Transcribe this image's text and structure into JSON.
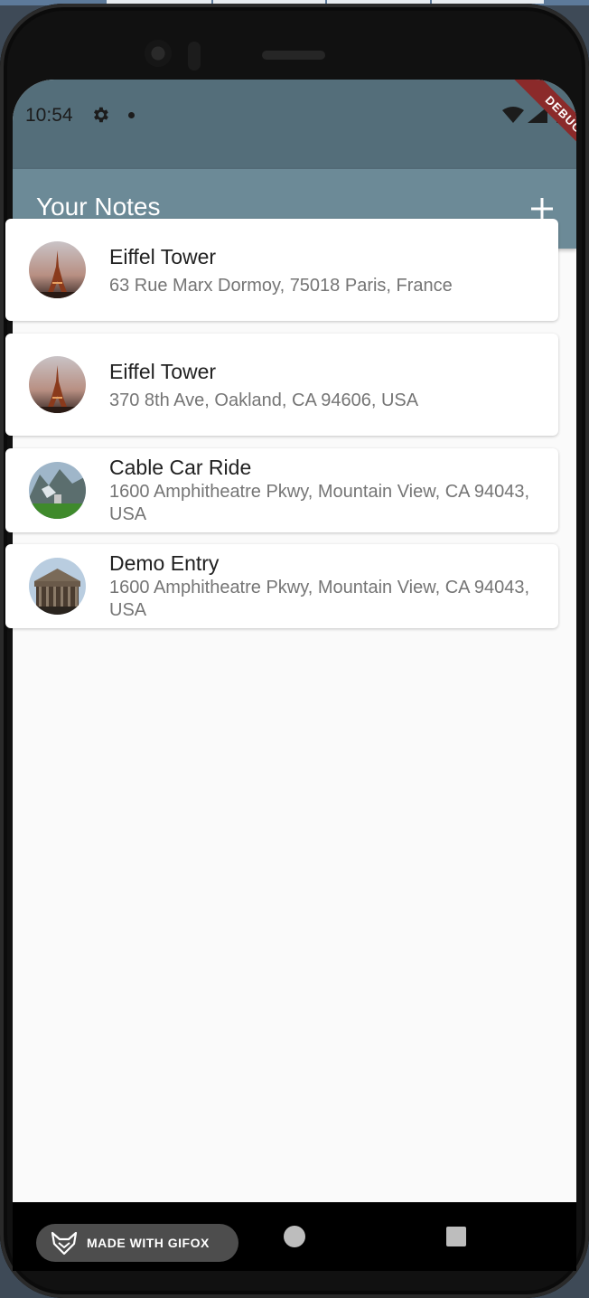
{
  "status_bar": {
    "time": "10:54",
    "debug_label": "DEBUG"
  },
  "app_bar": {
    "title": "Your Notes",
    "add_label": "+"
  },
  "notes": [
    {
      "title": "Eiffel Tower",
      "address": "63 Rue Marx Dormoy, 75018 Paris, France",
      "thumbnail": "eiffel-tower-photo"
    },
    {
      "title": "Eiffel Tower",
      "address": "370 8th Ave, Oakland, CA 94606, USA",
      "thumbnail": "eiffel-tower-photo"
    },
    {
      "title": "Cable Car Ride",
      "address": "1600 Amphitheatre Pkwy, Mountain View, CA 94043, USA",
      "thumbnail": "mountain-cable-car-photo"
    },
    {
      "title": "Demo Entry",
      "address": "1600 Amphitheatre Pkwy, Mountain View, CA 94043, USA",
      "thumbnail": "pantheon-photo"
    }
  ],
  "watermark": {
    "text": "MADE WITH GIFOX"
  },
  "colors": {
    "status_bar": "#546e7a",
    "app_bar": "#6c8a97",
    "background": "#fafafa"
  }
}
